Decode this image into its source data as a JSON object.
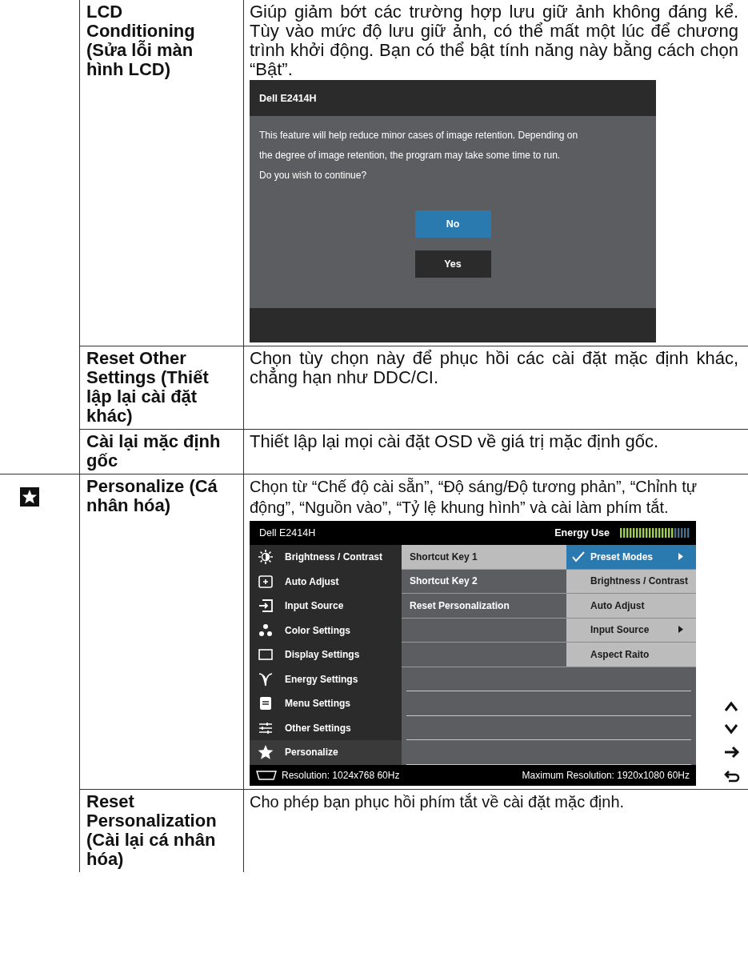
{
  "sections": [
    {
      "icon": false,
      "items": [
        {
          "name": "LCD Conditioning (Sửa lỗi màn hình LCD)",
          "description": "Giúp giảm bớt các trường hợp lưu giữ ảnh không đáng kể. Tùy vào mức độ lưu giữ ảnh, có thể mất một lúc để chương trình khởi động. Bạn có thể bật tính năng này bằng cách chọn “Bật”.",
          "screenshot": {
            "kind": "dialog",
            "title": "Dell E2414H",
            "message_lines": [
              "This feature will help reduce minor cases of image retention. Depending on",
              "the degree of image retention, the program may take some time to run.",
              "Do you wish to continue?"
            ],
            "buttons": [
              {
                "label": "No",
                "selected": true
              },
              {
                "label": "Yes",
                "selected": false
              }
            ]
          }
        },
        {
          "name": "Reset Other Settings (Thiết lập lại cài đặt khác)",
          "description": "Chọn tùy chọn này để phục hồi các cài đặt mặc định khác, chẳng hạn như DDC/CI."
        },
        {
          "name": "Cài lại mặc định gốc",
          "description": "Thiết lập lại mọi cài đặt OSD về giá trị mặc định gốc."
        }
      ]
    },
    {
      "icon": true,
      "items": [
        {
          "name": "Personalize (Cá nhân hóa)",
          "description": "Chọn từ “Chế độ cài sẵn”, “Độ sáng/Độ tương phản”, “Chỉnh tự động”, “Nguồn vào”, “Tỷ lệ khung hình” và cài làm phím tắt.",
          "screenshot": {
            "kind": "osd",
            "title": "Dell E2414H",
            "energy_label": "Energy Use",
            "energy_meter": {
              "level": 0.75
            },
            "main_items": [
              {
                "label": "Brightness / Contrast",
                "selected": false
              },
              {
                "label": "Auto Adjust",
                "selected": false
              },
              {
                "label": "Input Source",
                "selected": false
              },
              {
                "label": "Color Settings",
                "selected": false
              },
              {
                "label": "Display Settings",
                "selected": false
              },
              {
                "label": "Energy Settings",
                "selected": false
              },
              {
                "label": "Menu Settings",
                "selected": false
              },
              {
                "label": "Other Settings",
                "selected": false
              },
              {
                "label": "Personalize",
                "selected": true
              }
            ],
            "submenu": [
              {
                "label": "Shortcut Key 1",
                "selected": true
              },
              {
                "label": "Shortcut Key 2",
                "selected": false
              },
              {
                "label": "Reset Personalization",
                "selected": false
              }
            ],
            "options": [
              {
                "label": "Preset Modes",
                "selected": true,
                "checked": true,
                "has_submenu": true
              },
              {
                "label": "Brightness / Contrast",
                "selected": false,
                "checked": false,
                "has_submenu": false
              },
              {
                "label": "Auto Adjust",
                "selected": false,
                "checked": false,
                "has_submenu": false
              },
              {
                "label": "Input Source",
                "selected": false,
                "checked": false,
                "has_submenu": true
              },
              {
                "label": "Aspect Raito",
                "selected": false,
                "checked": false,
                "has_submenu": false
              }
            ],
            "resolution": "Resolution:  1024x768 60Hz",
            "max_resolution": "Maximum Resolution: 1920x1080 60Hz"
          }
        },
        {
          "name": "Reset Personalization (Cài lại cá nhân hóa)",
          "description": "Cho phép bạn phục hồi phím tắt về cài đặt mặc định."
        }
      ]
    }
  ]
}
